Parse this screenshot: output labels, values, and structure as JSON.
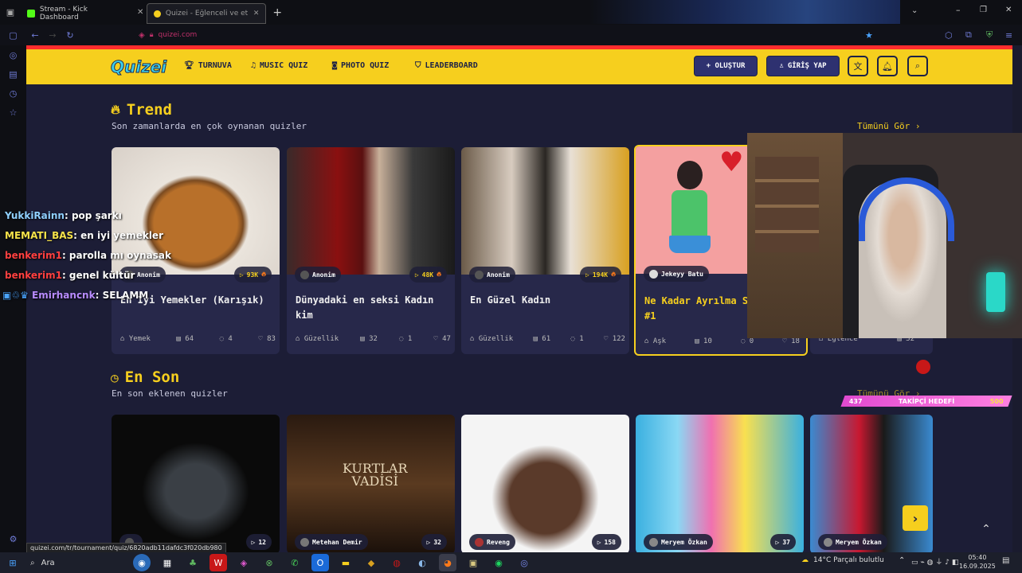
{
  "browser": {
    "tabs": [
      {
        "label": "Stream - Kick Dashboard"
      },
      {
        "label": "Quizei - Eğlenceli ve etkileşimli"
      }
    ],
    "url": "quizei.com",
    "status_url": "quizei.com/tr/tournament/quiz/6820adb11dafdc3f020db980"
  },
  "nav": {
    "logo": "Quizei",
    "links": [
      "TURNUVA",
      "MUSIC QUIZ",
      "PHOTO QUIZ",
      "LEADERBOARD"
    ],
    "create": "+ OLUŞTUR",
    "login": "GİRİŞ YAP"
  },
  "trend": {
    "title": "Trend",
    "subtitle": "Son zamanlarda en çok oynanan quizler",
    "see_all": "Tümünü Gör ›",
    "cards": [
      {
        "author": "Anonim",
        "plays": "93K",
        "title": "En İyi Yemekler (Karışık)",
        "category": "Yemek",
        "questions": "64",
        "comments": "4",
        "likes": "83"
      },
      {
        "author": "Anonim",
        "plays": "48K",
        "title": "Dünyadaki en seksi Kadın kim",
        "category": "Güzellik",
        "questions": "32",
        "comments": "1",
        "likes": "47"
      },
      {
        "author": "Anonim",
        "plays": "194K",
        "title": "En Güzel Kadın",
        "category": "Güzellik",
        "questions": "61",
        "comments": "1",
        "likes": "122"
      },
      {
        "author": "Jekeyy Batu",
        "plays": "",
        "title": "Ne Kadar Ayrılma Sebebi?? #1",
        "category": "Aşk",
        "questions": "10",
        "comments": "0",
        "likes": "18"
      },
      {
        "author": "",
        "plays": "",
        "title": "",
        "category": "Eğlence",
        "questions": "32",
        "comments": "",
        "likes": ""
      }
    ]
  },
  "latest": {
    "title": "En Son",
    "subtitle": "En son eklenen quizler",
    "see_all": "Tümünü Gör ›",
    "cards": [
      {
        "author": "",
        "plays": "12"
      },
      {
        "author": "Metehan Demir",
        "plays": "32"
      },
      {
        "author": "Reveng",
        "plays": "158"
      },
      {
        "author": "Meryem Özkan",
        "plays": "37"
      },
      {
        "author": "Meryem Özkan",
        "plays": ""
      }
    ]
  },
  "chat": [
    {
      "user": "YukkiRainn",
      "msg": ": pop şarkı",
      "color": "#8fd0ff"
    },
    {
      "user": "MEMATI_BAS",
      "msg": ": en iyi yemekler",
      "color": "#f6e24a"
    },
    {
      "user": "benkerim1",
      "msg": ": parolla mı oynasak",
      "color": "#ff4040"
    },
    {
      "user": "benkerim1",
      "msg": ": genel kültür",
      "color": "#ff4040"
    },
    {
      "user": "Emirhancnk",
      "msg": ": SELAMM",
      "color": "#b88cff"
    }
  ],
  "overlay": {
    "follower_goal": "TAKİPÇİ HEDEFİ",
    "current": "437",
    "target": "500"
  },
  "taskbar": {
    "search": "Ara",
    "weather": "14°C  Parçalı bulutlu",
    "time": "05:40",
    "date": "16.09.2025"
  }
}
